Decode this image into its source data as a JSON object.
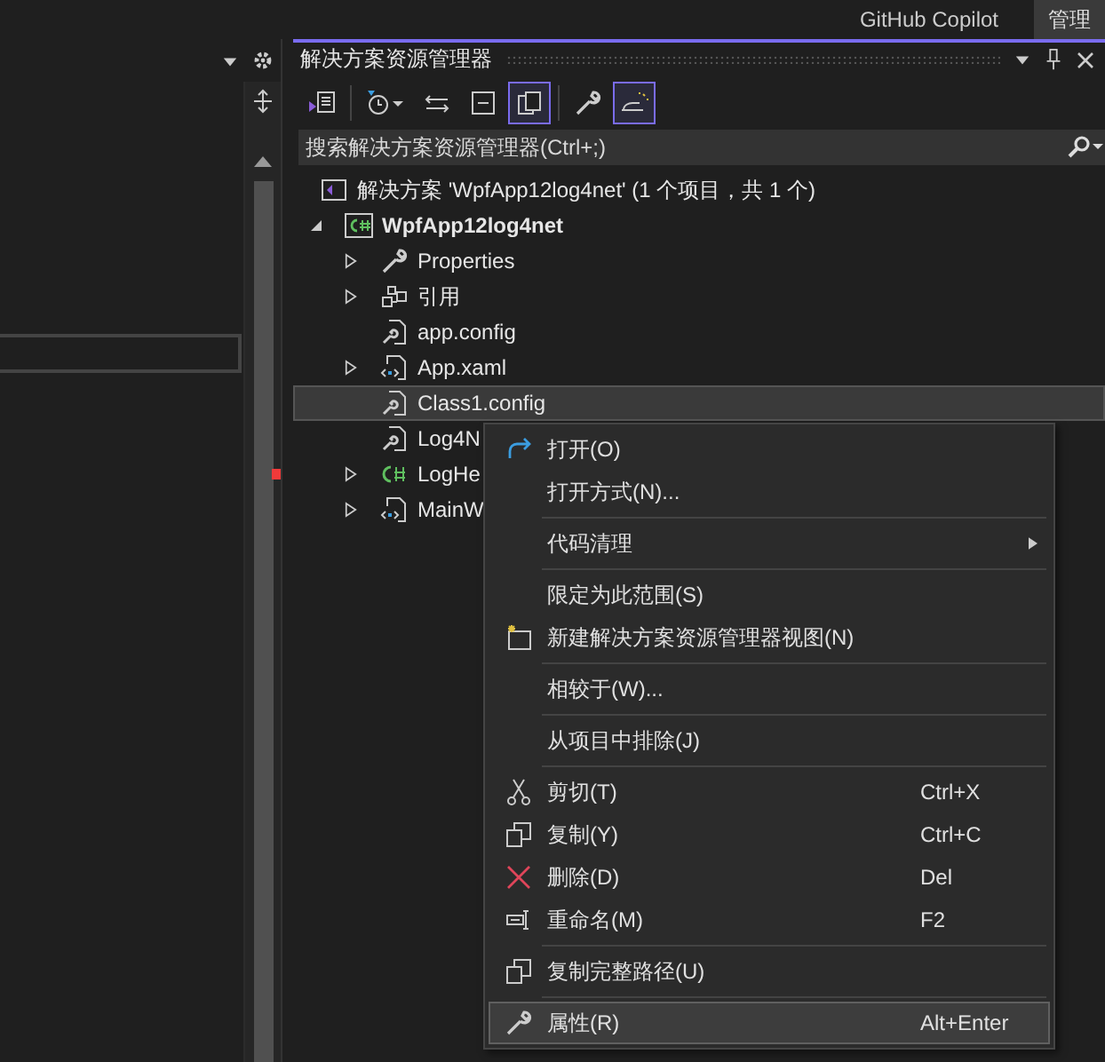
{
  "top_bar": {
    "copilot": "GitHub Copilot",
    "manage": "管理"
  },
  "solution_explorer": {
    "title": "解决方案资源管理器",
    "toolbar": [
      {
        "kind": "switch-views",
        "on": false
      },
      {
        "kind": "history",
        "on": false
      },
      {
        "kind": "sync",
        "on": false
      },
      {
        "kind": "collapse",
        "on": false
      },
      {
        "kind": "show-all",
        "on": true
      },
      {
        "kind": "properties",
        "on": false
      },
      {
        "kind": "preview",
        "on": true
      }
    ],
    "search": {
      "placeholder": "搜索解决方案资源管理器(Ctrl+;)"
    },
    "tree": [
      {
        "kind": "solution",
        "label": "解决方案 'WpfApp12log4net' (1 个项目，共 1 个)",
        "selected": false,
        "children": [
          {
            "kind": "project",
            "label": "WpfApp12log4net",
            "selected": false,
            "expanded": true,
            "children": [
              {
                "kind": "wrench",
                "label": "Properties",
                "selected": false,
                "expanded": false
              },
              {
                "kind": "references",
                "label": "引用",
                "selected": false,
                "expanded": false
              },
              {
                "kind": "config",
                "label": "app.config",
                "selected": false
              },
              {
                "kind": "xaml",
                "label": "App.xaml",
                "selected": false,
                "expanded": false
              },
              {
                "kind": "config",
                "label": "Class1.config",
                "selected": true
              },
              {
                "kind": "config",
                "label": "Log4N",
                "selected": false
              },
              {
                "kind": "csharp",
                "label": "LogHe",
                "selected": false,
                "expanded": false
              },
              {
                "kind": "xaml",
                "label": "MainW",
                "selected": false,
                "expanded": false
              }
            ]
          }
        ]
      }
    ]
  },
  "context_menu": [
    {
      "kind": "open",
      "label": "打开(O)",
      "selected": false
    },
    {
      "kind": "plain",
      "label": "打开方式(N)...",
      "selected": false
    },
    {
      "kind": "separator"
    },
    {
      "kind": "plain",
      "label": "代码清理",
      "submenu": true,
      "selected": false
    },
    {
      "kind": "separator"
    },
    {
      "kind": "plain",
      "label": "限定为此范围(S)",
      "selected": false
    },
    {
      "kind": "new-view",
      "label": "新建解决方案资源管理器视图(N)",
      "selected": false
    },
    {
      "kind": "separator"
    },
    {
      "kind": "plain",
      "label": "相较于(W)...",
      "selected": false
    },
    {
      "kind": "separator"
    },
    {
      "kind": "plain",
      "label": "从项目中排除(J)",
      "selected": false
    },
    {
      "kind": "separator"
    },
    {
      "kind": "cut",
      "label": "剪切(T)",
      "shortcut": "Ctrl+X",
      "selected": false
    },
    {
      "kind": "copy",
      "label": "复制(Y)",
      "shortcut": "Ctrl+C",
      "selected": false
    },
    {
      "kind": "delete",
      "label": "删除(D)",
      "shortcut": "Del",
      "selected": false
    },
    {
      "kind": "rename",
      "label": "重命名(M)",
      "shortcut": "F2",
      "selected": false
    },
    {
      "kind": "separator"
    },
    {
      "kind": "copy",
      "label": "复制完整路径(U)",
      "selected": false
    },
    {
      "kind": "separator"
    },
    {
      "kind": "properties",
      "label": "属性(R)",
      "shortcut": "Alt+Enter",
      "selected": true
    }
  ]
}
